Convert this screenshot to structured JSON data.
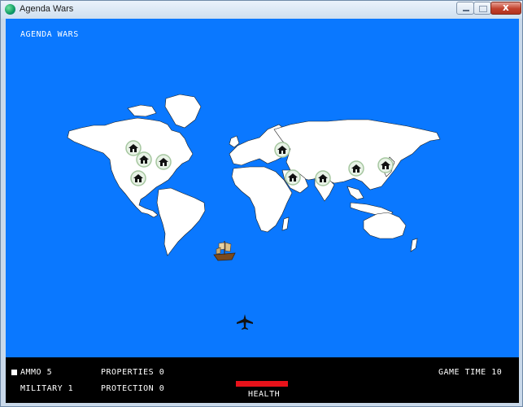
{
  "window": {
    "title": "Agenda Wars"
  },
  "game": {
    "title_label": "AGENDA WARS",
    "hud": {
      "ammo": "AMMO 5",
      "military": "MILITARY 1",
      "properties": "PROPERTIES 0",
      "protection": "PROTECTION 0",
      "game_time": "GAME TIME 10",
      "health_label": "HEALTH",
      "health_value": 1.0
    },
    "colors": {
      "sky": "#0a78ff",
      "land": "#ffffff",
      "hud": "#000000",
      "health": "#e8121a"
    },
    "icons": {
      "property": "house-icon",
      "player": "airplane-icon",
      "enemy": "ship-icon"
    }
  }
}
